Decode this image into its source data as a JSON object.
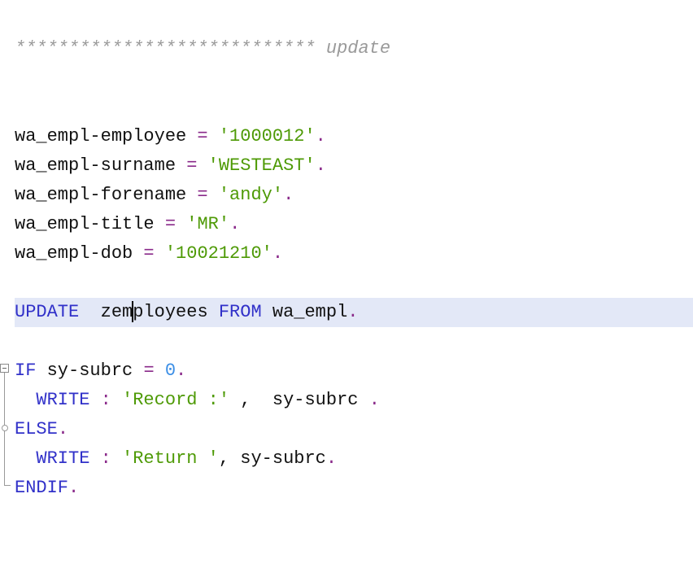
{
  "code": {
    "comment": {
      "stars": "****************************",
      "text": " update"
    },
    "assign1": {
      "lhs": "wa_empl-employee",
      "op": " = ",
      "val": "'1000012'",
      "end": "."
    },
    "assign2": {
      "lhs": "wa_empl-surname",
      "op": " = ",
      "val": "'WESTEAST'",
      "end": "."
    },
    "assign3": {
      "lhs": "wa_empl-forename",
      "op": " = ",
      "val": "'andy'",
      "end": "."
    },
    "assign4": {
      "lhs": "wa_empl-title",
      "op": " = ",
      "val": "'MR'",
      "end": "."
    },
    "assign5": {
      "lhs": "wa_empl-dob",
      "op": " = ",
      "val": "'10021210'",
      "end": "."
    },
    "update": {
      "kw": "UPDATE",
      "table_a": "  zem",
      "table_b": "ployees ",
      "from_kw": "FROM",
      "src": " wa_empl",
      "end": "."
    },
    "if_line": {
      "kw": "IF",
      "cond": " sy-subrc ",
      "op": "=",
      "num": " 0",
      "end": "."
    },
    "write1": {
      "indent": "  ",
      "kw": "WRITE",
      "colon": " : ",
      "str": "'Record :'",
      "rest": " ,  sy-subrc ",
      "end": "."
    },
    "else_line": {
      "kw": "ELSE",
      "end": "."
    },
    "write2": {
      "indent": "  ",
      "kw": "WRITE",
      "colon": " : ",
      "str": "'Return '",
      "rest": ", sy-subrc",
      "end": "."
    },
    "endif_line": {
      "kw": "ENDIF",
      "end": "."
    }
  },
  "colors": {
    "keyword": "#3131c9",
    "operator": "#8a2a8a",
    "string": "#4e9a06",
    "number": "#3c8fe6",
    "comment": "#9a9a9a",
    "current_line": "#e3e8f7"
  },
  "icons": {
    "fold": "fold-collapse-icon"
  }
}
